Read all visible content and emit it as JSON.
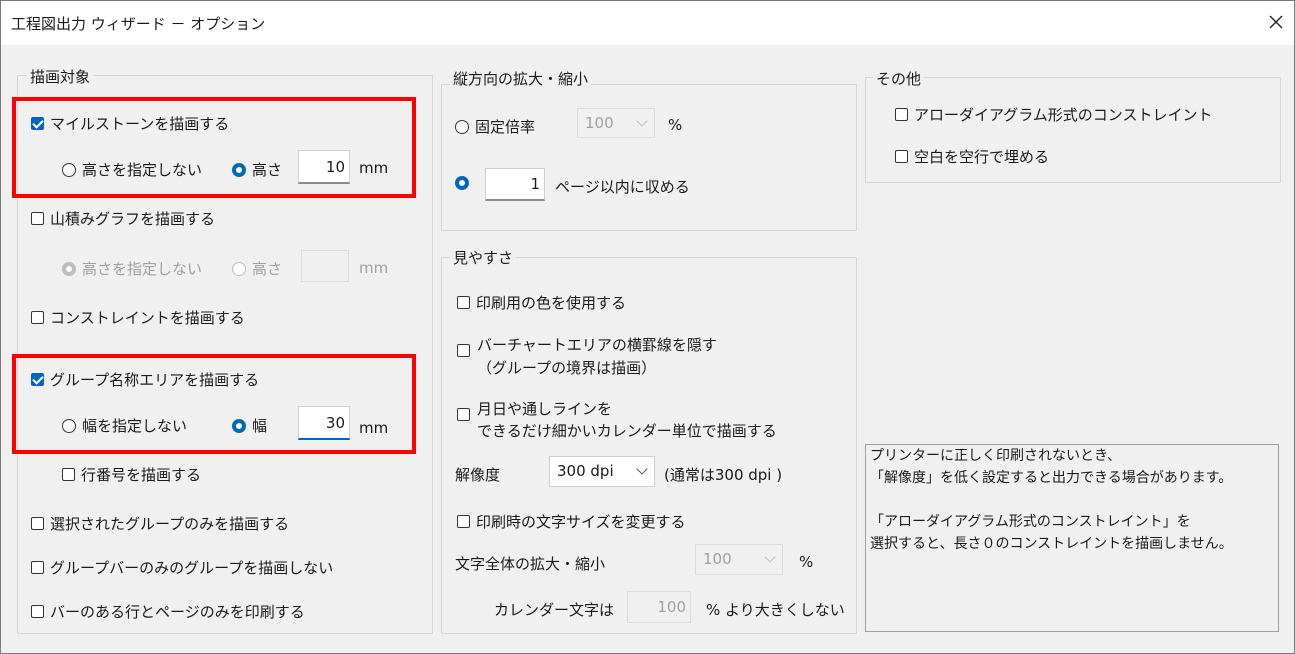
{
  "window": {
    "title": "工程図出力 ウィザード － オプション"
  },
  "draw_target": {
    "label": "描画対象",
    "milestone": {
      "label": "マイルストーンを描画する",
      "checked": true,
      "no_height": "高さを指定しない",
      "height": "高さ",
      "height_value": "10",
      "unit": "mm"
    },
    "stacked": {
      "label": "山積みグラフを描画する",
      "checked": false,
      "no_height": "高さを指定しない",
      "height": "高さ",
      "height_value": "",
      "unit": "mm"
    },
    "constraint": {
      "label": "コンストレイントを描画する",
      "checked": false
    },
    "group_name": {
      "label": "グループ名称エリアを描画する",
      "checked": true,
      "no_width": "幅を指定しない",
      "width": "幅",
      "width_value": "30",
      "unit": "mm"
    },
    "row_number": {
      "label": "行番号を描画する",
      "checked": false
    },
    "selected_groups": {
      "label": "選択されたグループのみを描画する",
      "checked": false
    },
    "group_bar_only": {
      "label": "グループバーのみのグループを描画しない",
      "checked": false
    },
    "bar_rows_pages": {
      "label": "バーのある行とページのみを印刷する",
      "checked": false
    }
  },
  "vertical": {
    "label": "縦方向の拡大・縮小",
    "fixed_label": "固定倍率",
    "fixed_value": "100",
    "percent": "%",
    "fit_value": "1",
    "fit_label": "ページ以内に収める"
  },
  "visibility": {
    "label": "見やすさ",
    "print_color": "印刷用の色を使用する",
    "hide_lines_1": "バーチャートエリアの横罫線を隠す",
    "hide_lines_2": "（グループの境界は描画）",
    "month_day_1": "月日や通しラインを",
    "month_day_2": "できるだけ細かいカレンダー単位で描画する",
    "resolution_label": "解像度",
    "resolution_value": "300 dpi",
    "resolution_note": "(通常は300 dpi )",
    "change_font_size": "印刷時の文字サイズを変更する",
    "text_scale_label": "文字全体の拡大・縮小",
    "text_scale_value": "100",
    "text_scale_unit": "%",
    "calendar_label": "カレンダー文字は",
    "calendar_value": "100",
    "calendar_note": "% より大きくしない"
  },
  "other": {
    "label": "その他",
    "arrow_diagram": "アローダイアグラム形式のコンストレイント",
    "fill_blank": "空白を空行で埋める"
  },
  "info": {
    "line1": "プリンターに正しく印刷されないとき、",
    "line2": "「解像度」を低く設定すると出力できる場合があります。",
    "line3": "「アローダイアグラム形式のコンストレイント」を",
    "line4": "選択すると、長さ０のコンストレイントを描画しません。"
  }
}
